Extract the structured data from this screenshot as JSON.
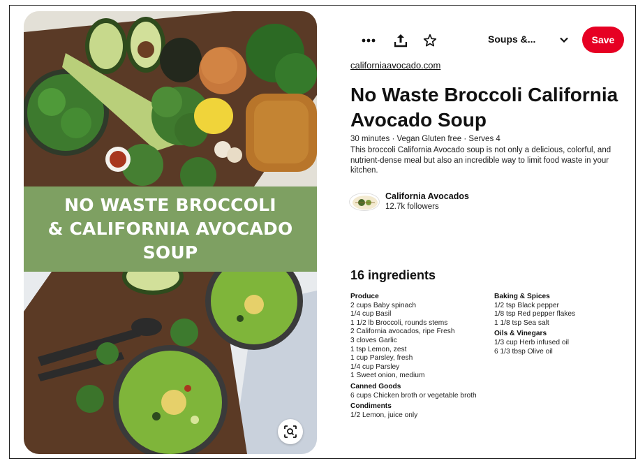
{
  "pin": {
    "banner_lines": [
      "NO WASTE BROCCOLI",
      "& CALIFORNIA AVOCADO",
      "SOUP"
    ]
  },
  "toolbar": {
    "more_icon": "more-dots-icon",
    "share_icon": "share-upload-icon",
    "favorite_icon": "star-icon",
    "board_label": "Soups &...",
    "save_label": "Save",
    "accent": "#e60023"
  },
  "source": {
    "domain": "californiaavocado.com"
  },
  "title": "No Waste Broccoli California Avocado Soup",
  "meta": "30 minutes · Vegan Gluten free · Serves 4",
  "description": "This broccoli California Avocado soup is not only a delicious, colorful, and nutrient-dense meal but also an incredible way to limit food waste in your kitchen.",
  "creator": {
    "name": "California Avocados",
    "followers": "12.7k followers"
  },
  "ingredients": {
    "title": "16 ingredients",
    "left": [
      {
        "heading": "Produce",
        "items": [
          "2 cups Baby spinach",
          "1/4 cup Basil",
          "1 1/2 lb Broccoli, rounds stems",
          "2 California avocados, ripe Fresh",
          "3 cloves Garlic",
          "1 tsp Lemon, zest",
          "1 cup Parsley, fresh",
          "1/4 cup Parsley",
          "1 Sweet onion, medium"
        ]
      },
      {
        "heading": "Canned Goods",
        "items": [
          "6 cups Chicken broth or vegetable broth"
        ]
      },
      {
        "heading": "Condiments",
        "items": [
          "1/2 Lemon, juice only"
        ]
      }
    ],
    "right": [
      {
        "heading": "Baking & Spices",
        "items": [
          "1/2 tsp Black pepper",
          "1/8 tsp Red pepper flakes",
          "1 1/8 tsp Sea salt"
        ]
      },
      {
        "heading": "Oils & Vinegars",
        "items": [
          "1/3 cup Herb infused oil",
          "6 1/3 tbsp Olive oil"
        ]
      }
    ]
  },
  "colors": {
    "banner_green": "#7ea062",
    "save_red": "#e60023"
  }
}
